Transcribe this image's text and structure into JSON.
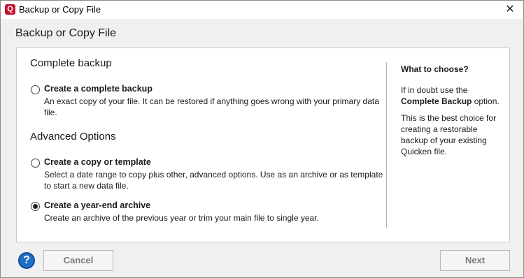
{
  "window": {
    "title": "Backup or Copy File",
    "app_icon": "Q",
    "close_glyph": "✕"
  },
  "header": {
    "title": "Backup or Copy File"
  },
  "complete_backup": {
    "section_title": "Complete backup",
    "option": {
      "label": "Create a complete backup",
      "description": "An exact copy of your file. It can be restored if anything goes wrong with your primary data file.",
      "selected": false
    }
  },
  "advanced": {
    "section_title": "Advanced Options",
    "options": [
      {
        "label": "Create a copy or template",
        "description": "Select a date range to copy plus other, advanced options. Use as an archive or as template to start a new data file.",
        "selected": false
      },
      {
        "label": "Create a year-end archive",
        "description": "Create an archive of the previous year or trim your main file to single year.",
        "selected": true
      }
    ]
  },
  "side": {
    "heading": "What to choose?",
    "p1_prefix": "If in doubt use the",
    "p1_bold": "Complete Backup",
    "p1_suffix": "option.",
    "p2": "This is the best choice for creating a restorable backup of your existing Quicken file."
  },
  "footer": {
    "help_glyph": "?",
    "cancel_label": "Cancel",
    "next_label": "Next"
  },
  "colors": {
    "accent": "#c8102e",
    "help_blue": "#1f6fc4"
  }
}
